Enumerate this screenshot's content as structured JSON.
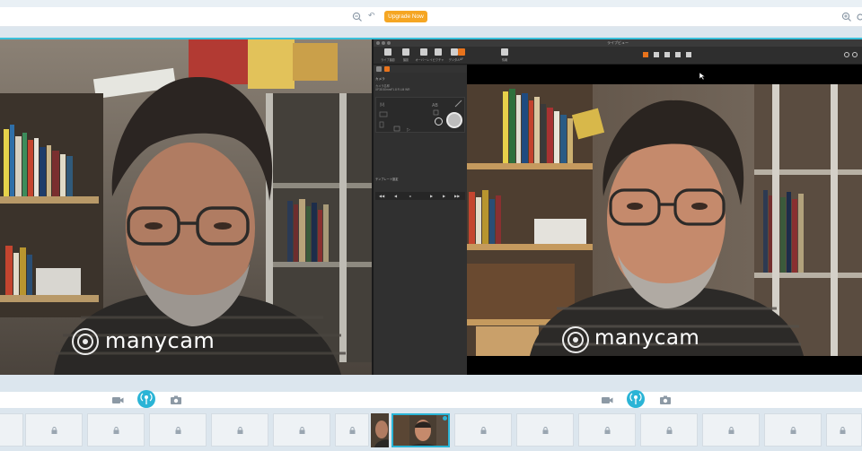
{
  "topbar": {
    "undo_label": "↶",
    "upgrade_label": "Upgrade Now"
  },
  "left_preview": {
    "watermark": "manycam"
  },
  "window": {
    "title": "ライブビュー",
    "toolbar": [
      {
        "label": "ライブ撮影",
        "icon": "pause-icon"
      },
      {
        "label": "撮影",
        "icon": "camera-icon"
      },
      {
        "label": "オーバーレイ",
        "icon": "list-icon"
      },
      {
        "label": "ピクチャ",
        "icon": "mail-icon"
      },
      {
        "label": "デジタル",
        "icon": "aspect-icon"
      },
      {
        "label": "AF",
        "icon": "af-icon"
      },
      {
        "label": "情報",
        "icon": "info-icon"
      }
    ],
    "panel": {
      "heading": "カメラ",
      "model": "カメラ名称",
      "model_detail": "XF35 50mmF1.8 R LM WR",
      "section2": "テンプレート設定"
    },
    "live_watermark": "manycam"
  },
  "controls": {
    "video_icon": "video-icon",
    "stream_icon": "broadcast-icon",
    "photo_icon": "camera-icon"
  },
  "colors": {
    "accent": "#3ac0da",
    "upgrade": "#f5a623",
    "af_orange": "#e8731c"
  }
}
